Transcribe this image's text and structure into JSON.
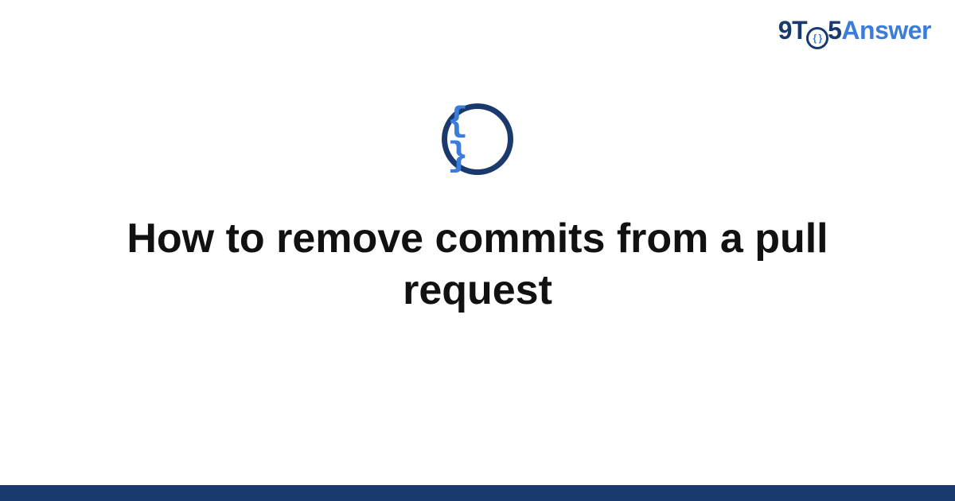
{
  "brand": {
    "part1": "9T",
    "o_inner": "{ }",
    "part2": "5",
    "part3": "Answer"
  },
  "center_icon_glyph": "{ }",
  "title": "How to remove commits from a pull request",
  "colors": {
    "brand_dark": "#1a3a6e",
    "brand_blue": "#3b7dd8"
  }
}
